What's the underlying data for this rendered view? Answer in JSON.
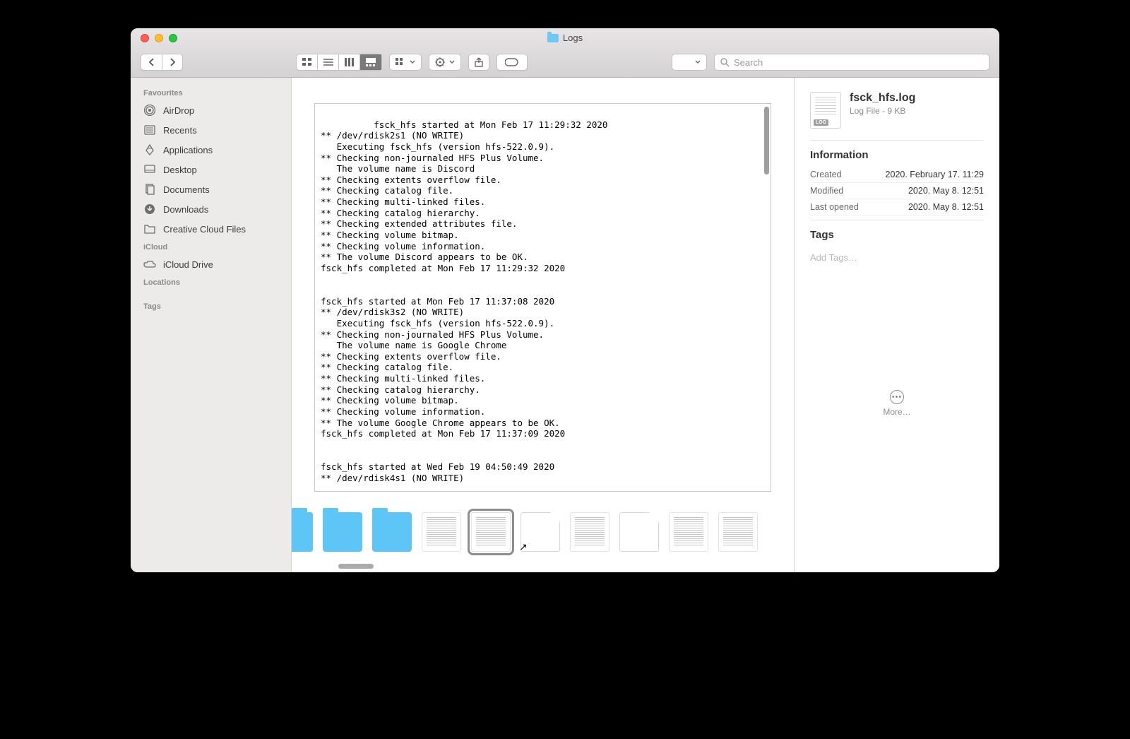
{
  "window": {
    "title": "Logs"
  },
  "toolbar": {
    "search_placeholder": "Search"
  },
  "sidebar": {
    "sections": [
      {
        "header": "Favourites",
        "items": [
          {
            "label": "AirDrop"
          },
          {
            "label": "Recents"
          },
          {
            "label": "Applications"
          },
          {
            "label": "Desktop"
          },
          {
            "label": "Documents"
          },
          {
            "label": "Downloads"
          },
          {
            "label": "Creative Cloud Files"
          }
        ]
      },
      {
        "header": "iCloud",
        "items": [
          {
            "label": "iCloud Drive"
          }
        ]
      },
      {
        "header": "Locations",
        "items": []
      },
      {
        "header": "Tags",
        "items": []
      }
    ]
  },
  "preview_text": "fsck_hfs started at Mon Feb 17 11:29:32 2020\n** /dev/rdisk2s1 (NO WRITE)\n   Executing fsck_hfs (version hfs-522.0.9).\n** Checking non-journaled HFS Plus Volume.\n   The volume name is Discord\n** Checking extents overflow file.\n** Checking catalog file.\n** Checking multi-linked files.\n** Checking catalog hierarchy.\n** Checking extended attributes file.\n** Checking volume bitmap.\n** Checking volume information.\n** The volume Discord appears to be OK.\nfsck_hfs completed at Mon Feb 17 11:29:32 2020\n\n\nfsck_hfs started at Mon Feb 17 11:37:08 2020\n** /dev/rdisk3s2 (NO WRITE)\n   Executing fsck_hfs (version hfs-522.0.9).\n** Checking non-journaled HFS Plus Volume.\n   The volume name is Google Chrome\n** Checking extents overflow file.\n** Checking catalog file.\n** Checking multi-linked files.\n** Checking catalog hierarchy.\n** Checking volume bitmap.\n** Checking volume information.\n** The volume Google Chrome appears to be OK.\nfsck_hfs completed at Mon Feb 17 11:37:09 2020\n\n\nfsck_hfs started at Wed Feb 19 04:50:49 2020\n** /dev/rdisk4s1 (NO WRITE)",
  "info": {
    "filename": "fsck_hfs.log",
    "subtitle": "Log File - 9 KB",
    "section_information": "Information",
    "rows": [
      {
        "k": "Created",
        "v": "2020. February 17. 11:29"
      },
      {
        "k": "Modified",
        "v": "2020. May 8. 12:51"
      },
      {
        "k": "Last opened",
        "v": "2020. May 8. 12:51"
      }
    ],
    "section_tags": "Tags",
    "tags_placeholder": "Add Tags…",
    "more_label": "More…"
  }
}
